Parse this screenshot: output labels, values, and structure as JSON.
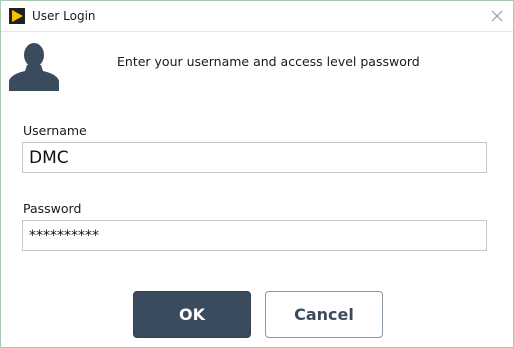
{
  "window": {
    "title": "User Login",
    "icon": "labview-run-arrow-icon",
    "close_glyph": "×"
  },
  "header": {
    "icon": "user-silhouette-icon",
    "instruction": "Enter your username and access level password"
  },
  "form": {
    "username": {
      "label": "Username",
      "value": "DMC"
    },
    "password": {
      "label": "Password",
      "value": "**********"
    }
  },
  "buttons": {
    "ok_label": "OK",
    "cancel_label": "Cancel"
  },
  "colors": {
    "ok_bg": "#3b4b5e",
    "cancel_text": "#3b4b5e",
    "window_border": "#a9c9b0",
    "icon_yellow": "#f5c400",
    "user_icon": "#3b4b5e"
  }
}
